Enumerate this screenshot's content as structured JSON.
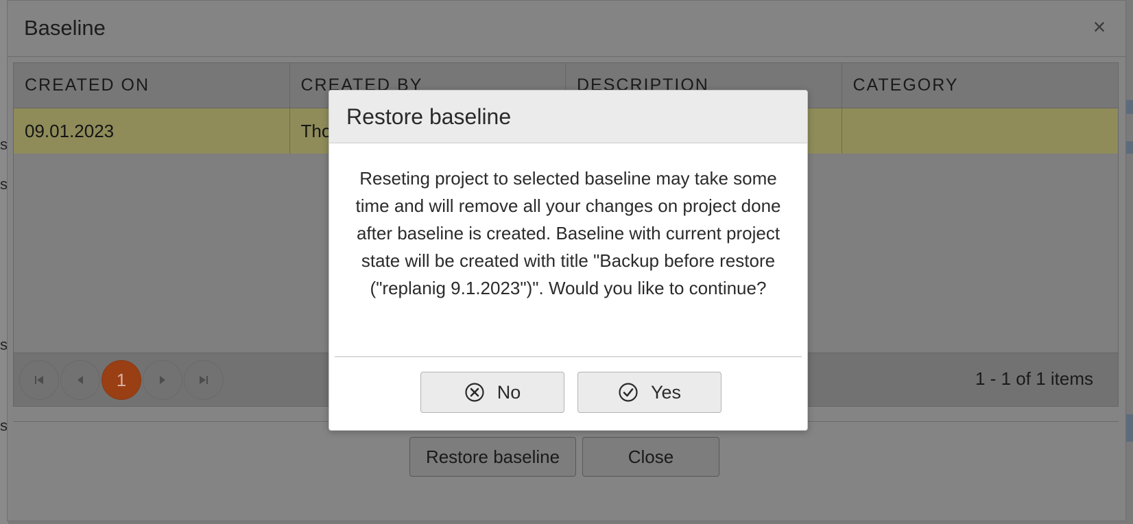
{
  "window": {
    "title": "Baseline",
    "close_glyph": "×"
  },
  "grid": {
    "columns": [
      "CREATED ON",
      "CREATED BY",
      "DESCRIPTION",
      "CATEGORY"
    ],
    "rows": [
      {
        "created_on": "09.01.2023",
        "created_by": "Tho",
        "description": "",
        "category": ""
      }
    ],
    "pager": {
      "first_glyph": "⏮",
      "prev_glyph": "◀",
      "current_page": "1",
      "next_glyph": "▶",
      "last_glyph": "⏭",
      "info": "1 - 1 of 1 items"
    }
  },
  "footer": {
    "restore_label": "Restore baseline",
    "close_label": "Close"
  },
  "modal": {
    "title": "Restore baseline",
    "message_lines": [
      "Reseting project to selected baseline may take some",
      "time and will remove all your changes on project done",
      "after baseline is created. Baseline with current project",
      "state will be created with title \"Backup before restore",
      "(\"replanig 9.1.2023\")\". Would you like to continue?"
    ],
    "no_label": "No",
    "yes_label": "Yes",
    "no_icon": "close-circle-icon",
    "yes_icon": "check-circle-icon"
  },
  "background": {
    "fragments": [
      "s",
      "s",
      "s",
      "s"
    ]
  },
  "colors": {
    "overlay_gray": "#7a7a7a",
    "selected_row": "#8f8c5a",
    "active_page": "#9a3e14",
    "modal_header": "#ebebeb"
  }
}
